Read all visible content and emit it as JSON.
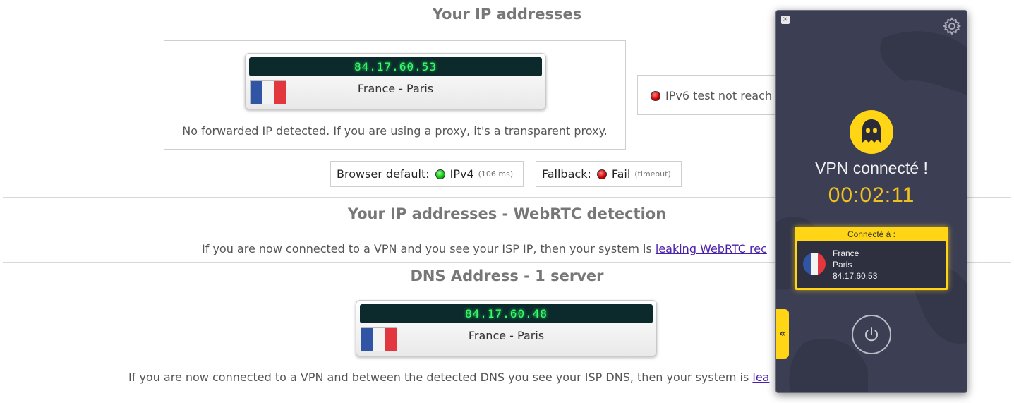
{
  "ip_section": {
    "title": "Your IP addresses",
    "ipv4": {
      "address": "84.17.60.53",
      "location": "France - Paris"
    },
    "forwarded_note": "No forwarded IP detected. If you are using a proxy, it's a transparent proxy.",
    "ipv6_status": "IPv6 test not reach",
    "browser_default": {
      "label": "Browser default:",
      "protocol": "IPv4",
      "timing": "(106 ms)"
    },
    "fallback": {
      "label": "Fallback:",
      "result": "Fail",
      "detail": "(timeout)"
    }
  },
  "webrtc_section": {
    "title": "Your IP addresses - WebRTC detection",
    "note": "If you are now connected to a VPN and you see your ISP IP, then your system is ",
    "link": "leaking WebRTC rec"
  },
  "dns_section": {
    "title": "DNS Address - 1 server",
    "dns": {
      "address": "84.17.60.48",
      "location": "France - Paris"
    },
    "note": "If you are now connected to a VPN and between the detected DNS you see your ISP DNS, then your system is ",
    "link": "lea"
  },
  "vpn": {
    "close_symbol": "×",
    "status": "VPN connecté !",
    "timer": "00:02:11",
    "connected_to_label": "Connecté à :",
    "country": "France",
    "city": "Paris",
    "ip": "84.17.60.53",
    "collapse_symbol": "«",
    "icons": {
      "settings": "gear-icon",
      "power": "power-icon",
      "logo": "ghost-logo-icon",
      "flag": "france-flag-icon"
    },
    "colors": {
      "accent": "#ffd516",
      "background": "#3c3e54",
      "timer": "#f0c020"
    }
  },
  "colors": {
    "ip_display_bg": "#0c2a2c",
    "ip_display_text": "#39ff6a",
    "status_ok": "#10c010",
    "status_fail": "#d00000",
    "link": "#4a1fa8"
  }
}
